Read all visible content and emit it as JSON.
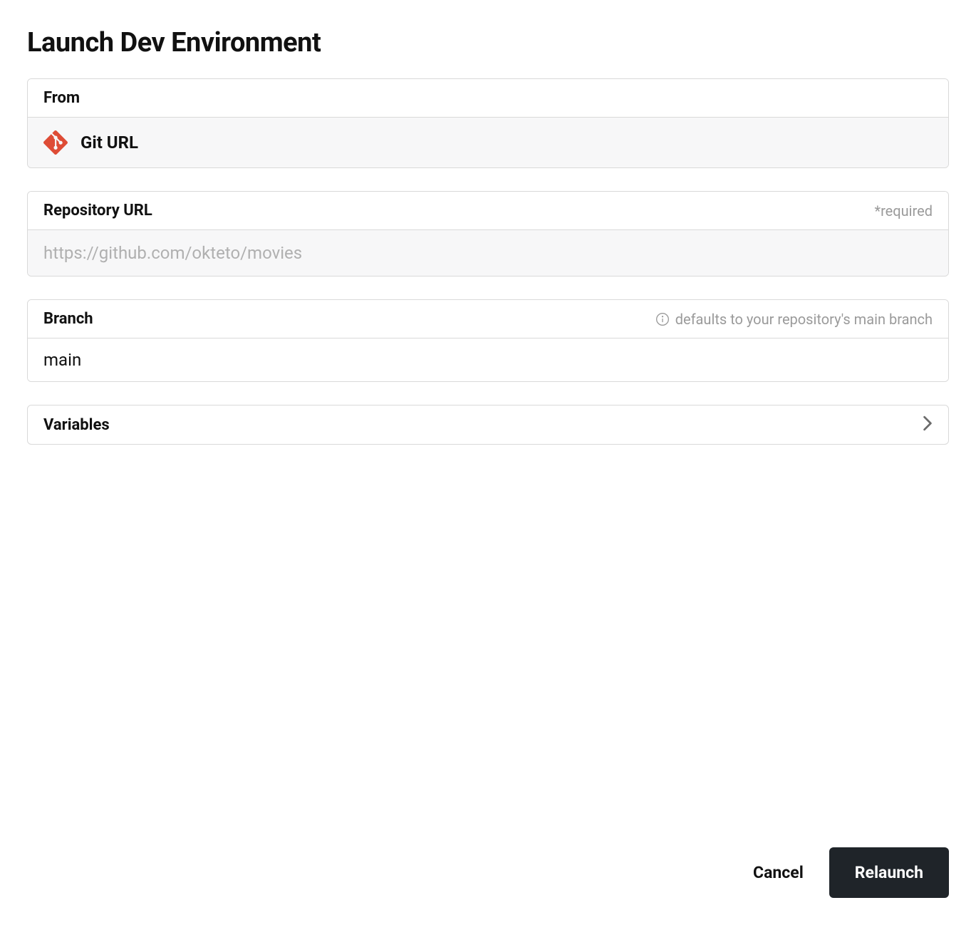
{
  "title": "Launch Dev Environment",
  "from": {
    "label": "From",
    "source_label": "Git URL"
  },
  "repository": {
    "label": "Repository URL",
    "hint": "*required",
    "placeholder": "https://github.com/okteto/movies",
    "value": ""
  },
  "branch": {
    "label": "Branch",
    "hint": "defaults to your repository's main branch",
    "value": "main"
  },
  "variables": {
    "label": "Variables"
  },
  "footer": {
    "cancel": "Cancel",
    "relaunch": "Relaunch"
  }
}
